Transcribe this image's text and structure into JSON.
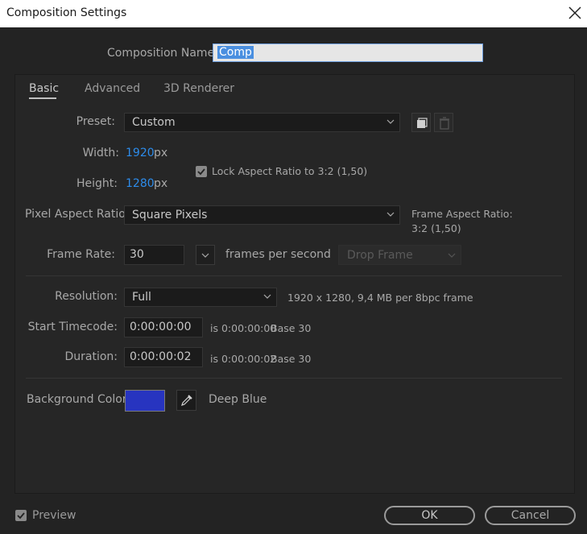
{
  "window": {
    "title": "Composition Settings"
  },
  "composition_name": {
    "label": "Composition Name:",
    "value": "Comp"
  },
  "tabs": [
    {
      "label": "Basic",
      "active": true
    },
    {
      "label": "Advanced",
      "active": false
    },
    {
      "label": "3D Renderer",
      "active": false
    }
  ],
  "preset": {
    "label": "Preset:",
    "value": "Custom"
  },
  "width": {
    "label": "Width:",
    "value": "1920",
    "unit": "px"
  },
  "height": {
    "label": "Height:",
    "value": "1280",
    "unit": "px"
  },
  "lock_aspect": {
    "label": "Lock Aspect Ratio to 3:2 (1,50)",
    "checked": true
  },
  "pixel_aspect": {
    "label": "Pixel Aspect Ratio:",
    "value": "Square Pixels",
    "frame_aspect_label": "Frame Aspect Ratio:",
    "frame_aspect_value": "3:2 (1,50)"
  },
  "frame_rate": {
    "label": "Frame Rate:",
    "value": "30",
    "unit": "frames per second",
    "drop_frame": "Drop Frame"
  },
  "resolution": {
    "label": "Resolution:",
    "value": "Full",
    "info": "1920 x 1280, 9,4 MB per 8bpc frame"
  },
  "start_timecode": {
    "label": "Start Timecode:",
    "value": "0:00:00:00",
    "is_text": "is 0:00:00:00",
    "base": "Base 30"
  },
  "duration": {
    "label": "Duration:",
    "value": "0:00:00:02",
    "is_text": "is 0:00:00:02",
    "base": "Base 30"
  },
  "background_color": {
    "label": "Background Color:",
    "name": "Deep Blue",
    "color": "#2734c0"
  },
  "preview": {
    "label": "Preview",
    "checked": true
  },
  "buttons": {
    "ok": "OK",
    "cancel": "Cancel"
  }
}
